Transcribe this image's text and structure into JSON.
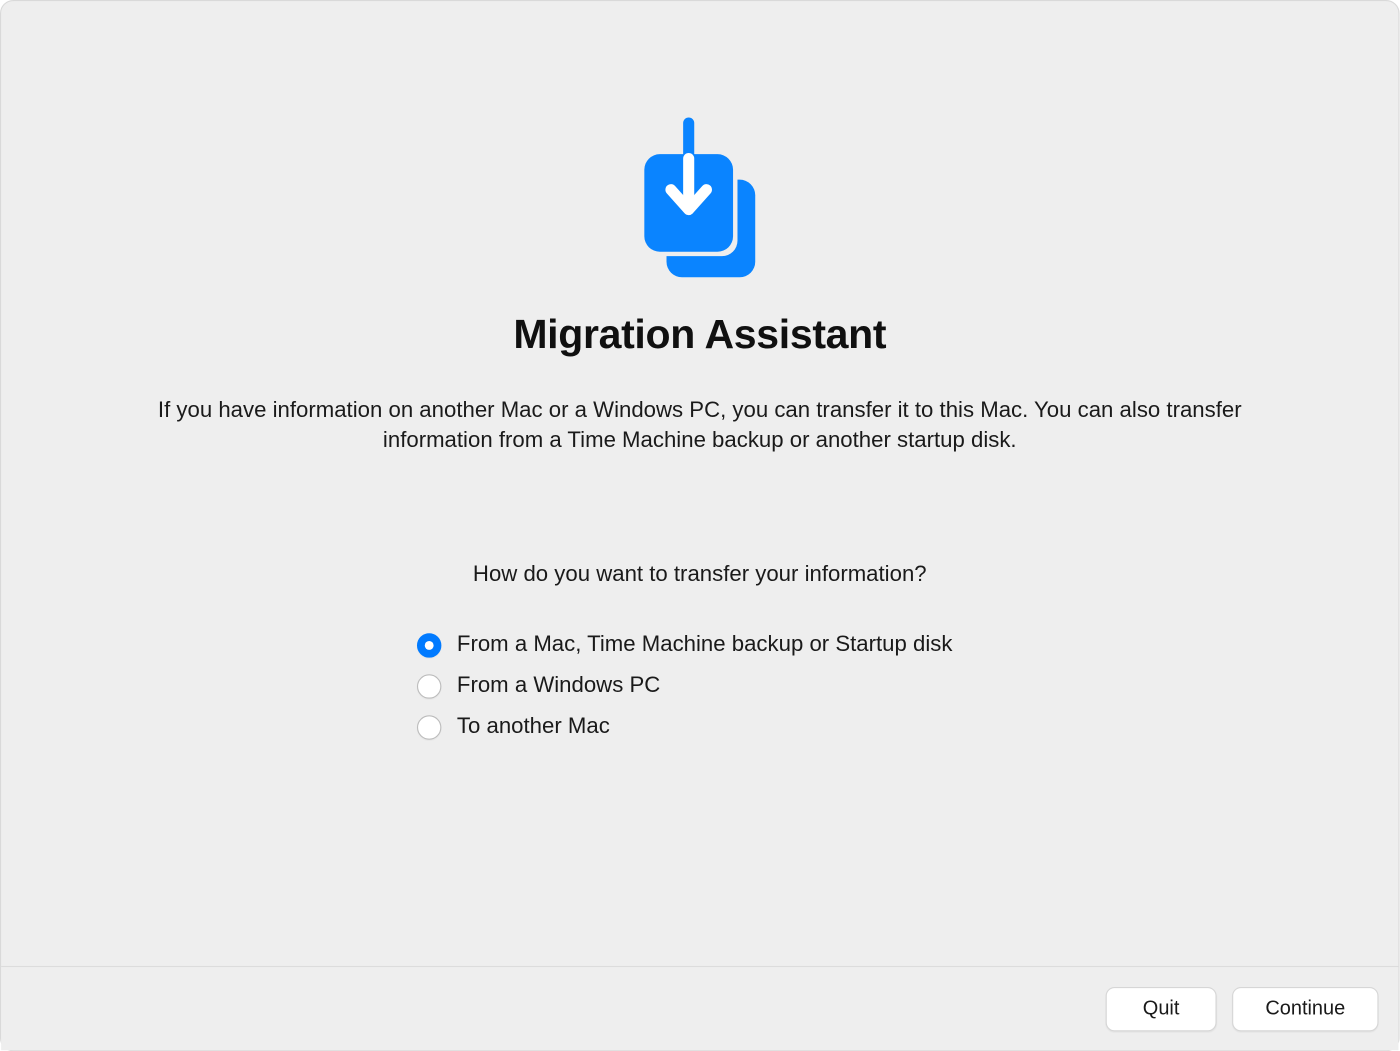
{
  "title": "Migration Assistant",
  "description": "If you have information on another Mac or a Windows PC, you can transfer it to this Mac. You can also transfer information from a Time Machine backup or another startup disk.",
  "prompt": "How do you want to transfer your information?",
  "options": [
    {
      "label": "From a Mac, Time Machine backup or Startup disk",
      "selected": true
    },
    {
      "label": "From a Windows PC",
      "selected": false
    },
    {
      "label": "To another Mac",
      "selected": false
    }
  ],
  "buttons": {
    "quit": "Quit",
    "continue": "Continue"
  },
  "colors": {
    "accent": "#007aff",
    "background": "#eeeeee"
  },
  "icon": "migration-download-icon"
}
